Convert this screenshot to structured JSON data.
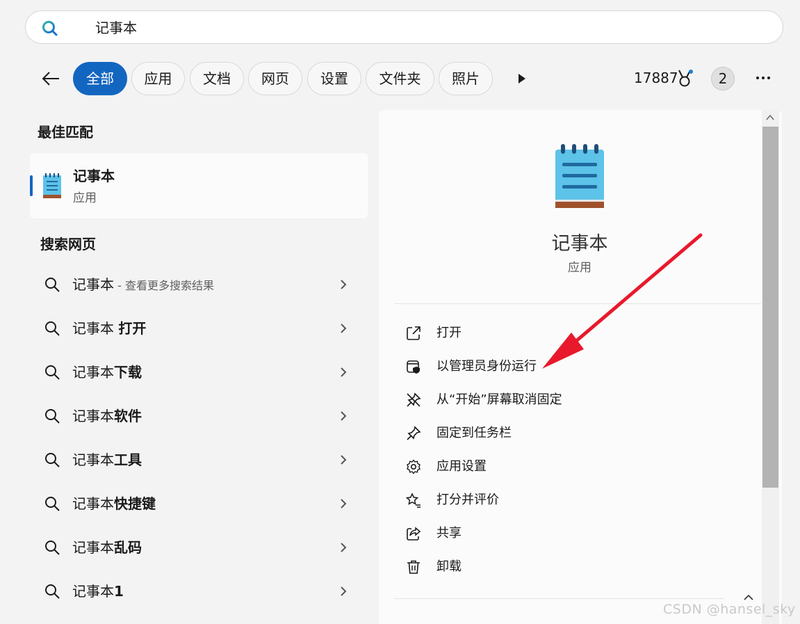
{
  "search": {
    "value": "记事本"
  },
  "filters": {
    "tabs": [
      {
        "label": "全部",
        "active": true
      },
      {
        "label": "应用",
        "active": false
      },
      {
        "label": "文档",
        "active": false
      },
      {
        "label": "网页",
        "active": false
      },
      {
        "label": "设置",
        "active": false
      },
      {
        "label": "文件夹",
        "active": false
      },
      {
        "label": "照片",
        "active": false
      }
    ],
    "points": "17887",
    "badge_count": "2"
  },
  "best_match": {
    "heading": "最佳匹配",
    "title": "记事本",
    "subtitle": "应用"
  },
  "web_search": {
    "heading": "搜索网页",
    "items": [
      {
        "prefix": "记事本",
        "bold": "",
        "hint": " - 查看更多搜索结果"
      },
      {
        "prefix": "记事本 ",
        "bold": "打开",
        "hint": ""
      },
      {
        "prefix": "记事本",
        "bold": "下载",
        "hint": ""
      },
      {
        "prefix": "记事本",
        "bold": "软件",
        "hint": ""
      },
      {
        "prefix": "记事本",
        "bold": "工具",
        "hint": ""
      },
      {
        "prefix": "记事本",
        "bold": "快捷键",
        "hint": ""
      },
      {
        "prefix": "记事本",
        "bold": "乱码",
        "hint": ""
      },
      {
        "prefix": "记事本",
        "bold": "1",
        "hint": ""
      }
    ]
  },
  "detail": {
    "title": "记事本",
    "subtitle": "应用",
    "actions": [
      {
        "label": "打开",
        "icon": "open-external-icon"
      },
      {
        "label": "以管理员身份运行",
        "icon": "admin-shield-icon"
      },
      {
        "label": "从“开始”屏幕取消固定",
        "icon": "unpin-icon"
      },
      {
        "label": "固定到任务栏",
        "icon": "pin-icon"
      },
      {
        "label": "应用设置",
        "icon": "gear-icon"
      },
      {
        "label": "打分并评价",
        "icon": "star-rate-icon"
      },
      {
        "label": "共享",
        "icon": "share-icon"
      },
      {
        "label": "卸载",
        "icon": "trash-icon"
      }
    ]
  },
  "watermark": "CSDN @hansel_sky",
  "colors": {
    "accent": "#1366c0",
    "arrow": "#e8192c"
  }
}
